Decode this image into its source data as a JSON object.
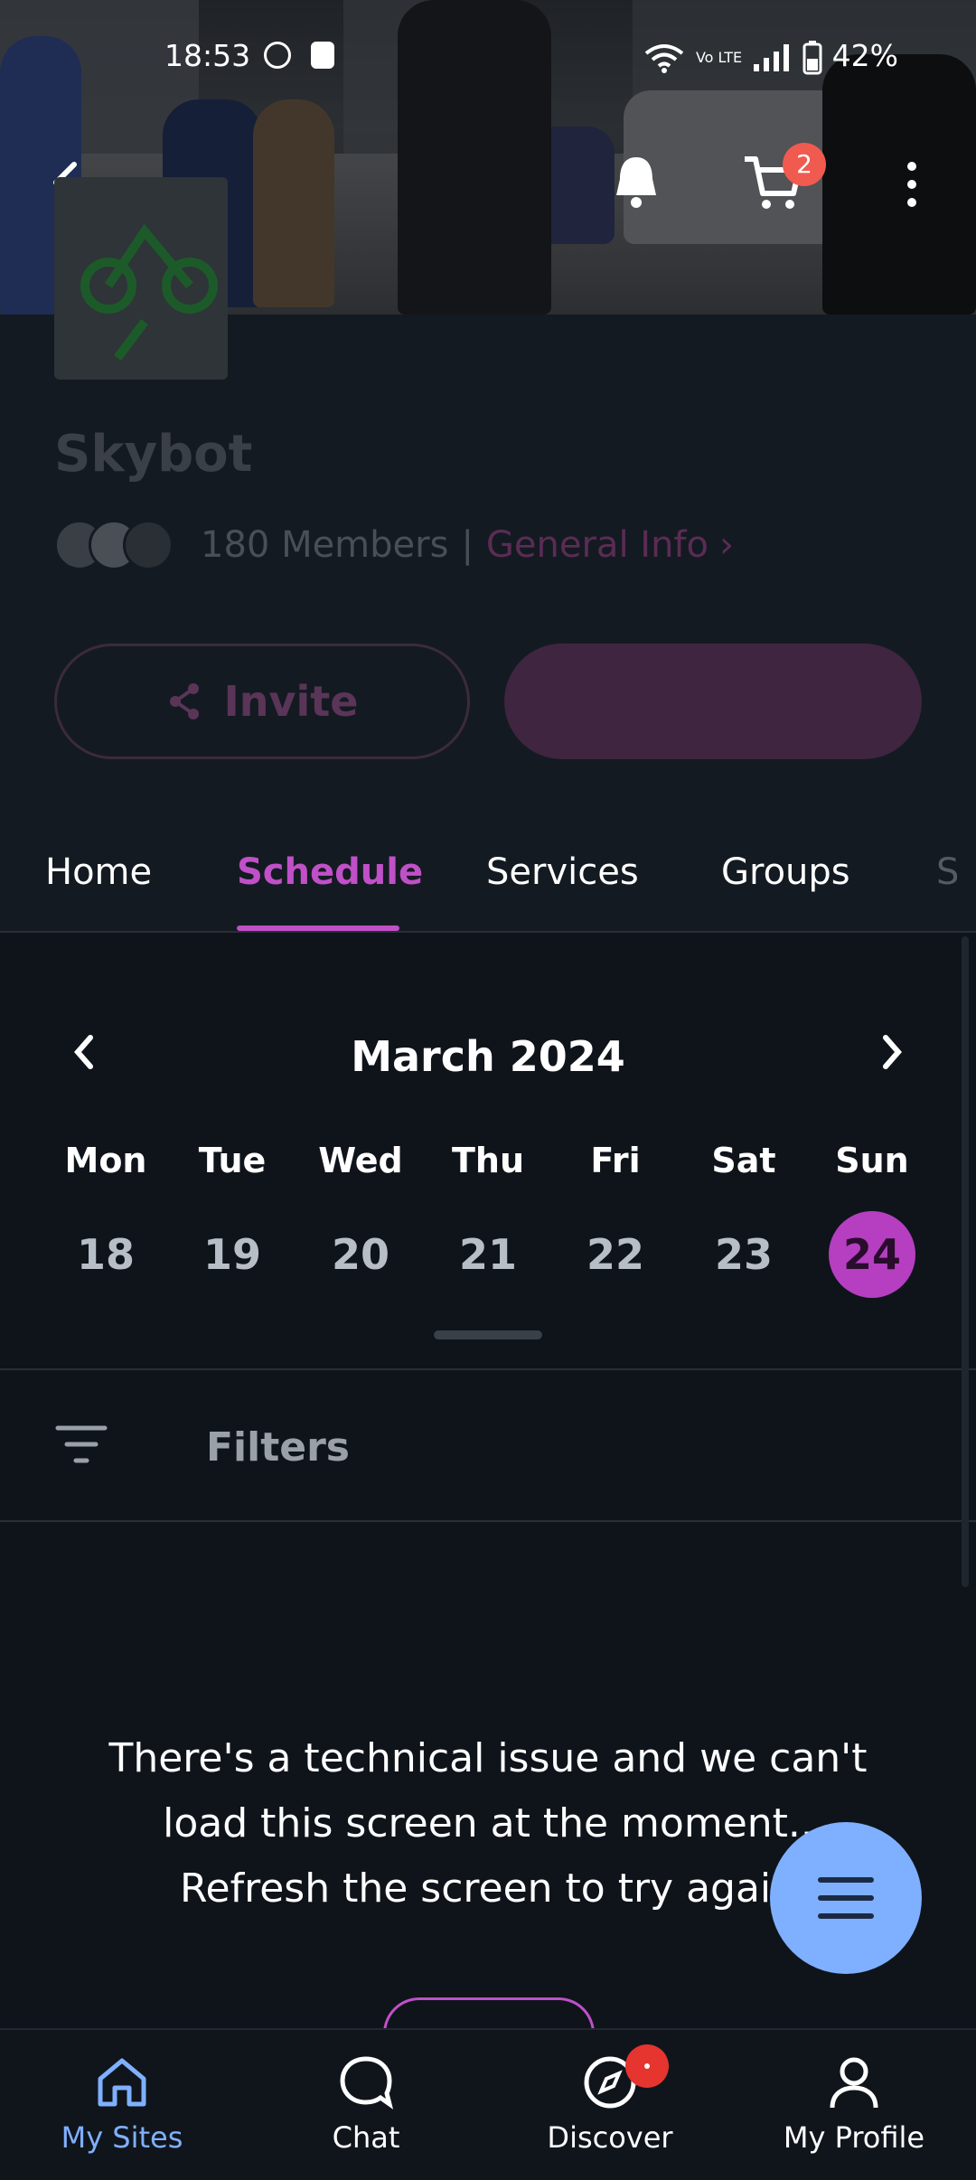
{
  "status_bar": {
    "time": "18:53",
    "network": "Vo LTE",
    "battery": "42%"
  },
  "header": {
    "cart_count": "2"
  },
  "site": {
    "name": "Skybot",
    "members": "180 Members",
    "separator": "|",
    "general_info": "General Info",
    "invite_label": "Invite"
  },
  "tabs": [
    {
      "label": "Home"
    },
    {
      "label": "Schedule",
      "active": true
    },
    {
      "label": "Services"
    },
    {
      "label": "Groups"
    },
    {
      "label": "S"
    }
  ],
  "calendar": {
    "month": "March 2024",
    "days": [
      {
        "name": "Mon",
        "num": "18"
      },
      {
        "name": "Tue",
        "num": "19"
      },
      {
        "name": "Wed",
        "num": "20"
      },
      {
        "name": "Thu",
        "num": "21"
      },
      {
        "name": "Fri",
        "num": "22"
      },
      {
        "name": "Sat",
        "num": "23"
      },
      {
        "name": "Sun",
        "num": "24",
        "selected": true
      }
    ]
  },
  "filters": {
    "label": "Filters"
  },
  "error": {
    "line1": "There's a technical issue and we can't",
    "line2": "load this screen at the moment..",
    "line3": "Refresh the screen to try again"
  },
  "bottom_nav": [
    {
      "label": "My Sites",
      "icon": "home-icon",
      "active": true
    },
    {
      "label": "Chat",
      "icon": "chat-icon"
    },
    {
      "label": "Discover",
      "icon": "compass-icon",
      "badge": true
    },
    {
      "label": "My Profile",
      "icon": "profile-icon"
    }
  ],
  "colors": {
    "accent": "#c050c8",
    "nav_active": "#7fb0ff",
    "background": "#0f141b"
  }
}
